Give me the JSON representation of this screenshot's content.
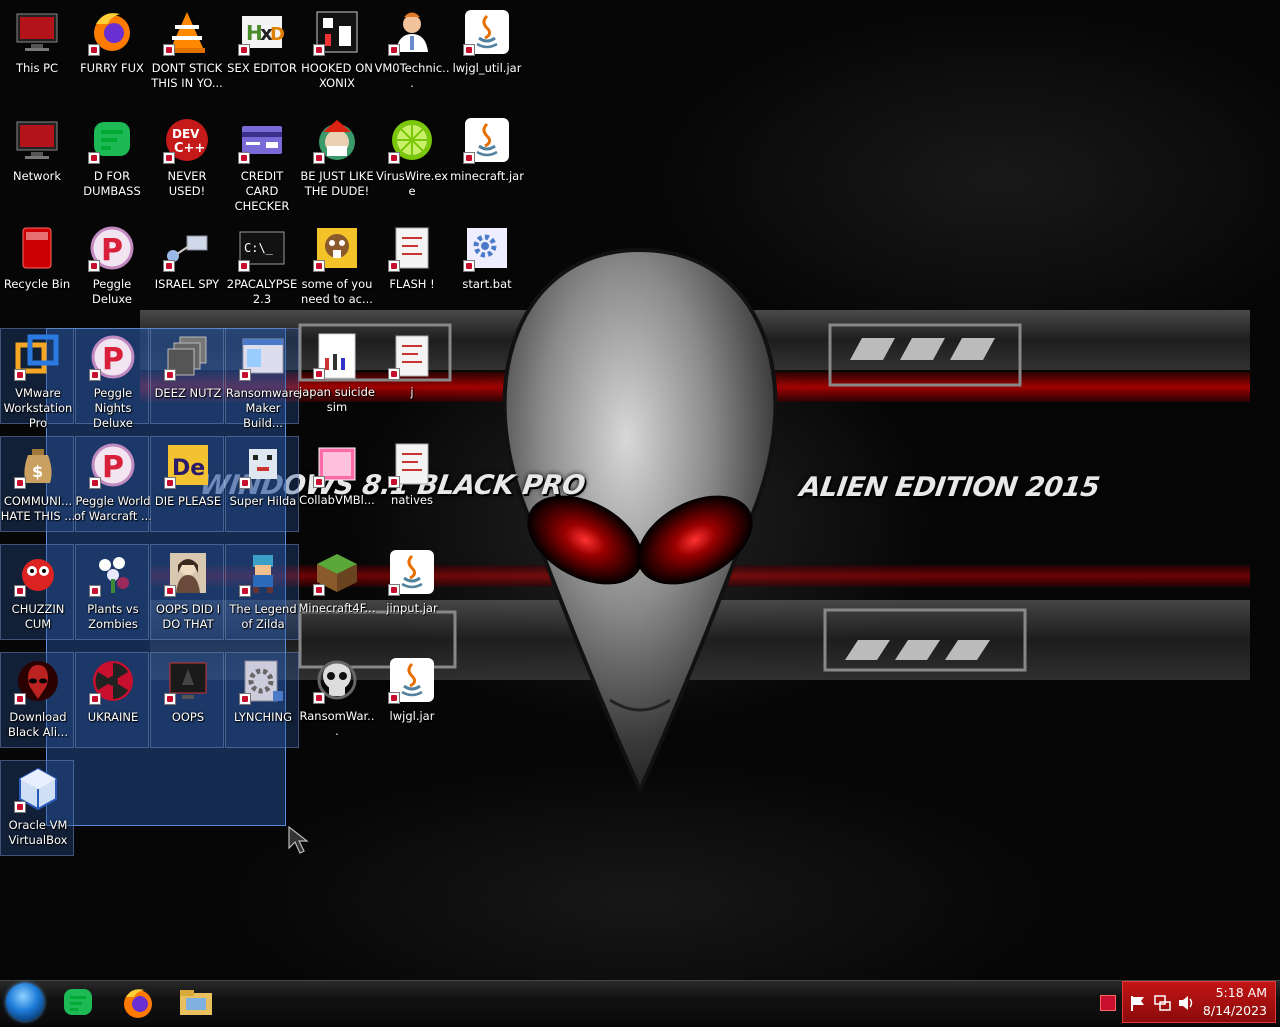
{
  "wallpaper": {
    "left_title": "WINDOWS 8.1 BLACK PRO",
    "right_title": "ALIEN EDITION 2015"
  },
  "desktop_icons": [
    {
      "label": "This PC",
      "icon": "computer-icon"
    },
    {
      "label": "FURRY FUX",
      "icon": "firefox-icon"
    },
    {
      "label": "DONT STICK THIS IN YO...",
      "icon": "vlc-icon"
    },
    {
      "label": "SEX EDITOR",
      "icon": "hex-editor-icon"
    },
    {
      "label": "HOOKED ON XONIX",
      "icon": "xonix-game-icon"
    },
    {
      "label": "VM0Technic...",
      "icon": "doctor-icon"
    },
    {
      "label": "lwjgl_util.jar",
      "icon": "java-icon"
    },
    {
      "label": "Network",
      "icon": "network-icon"
    },
    {
      "label": "D FOR DUMBASS",
      "icon": "chat-icon"
    },
    {
      "label": "NEVER USED!",
      "icon": "dev-cpp-icon"
    },
    {
      "label": "CREDIT CARD CHECKER",
      "icon": "credit-card-icon"
    },
    {
      "label": "BE JUST LIKE THE DUDE!",
      "icon": "santa-icon"
    },
    {
      "label": "VirusWire.exe",
      "icon": "lime-icon"
    },
    {
      "label": "minecraft.jar",
      "icon": "java-icon"
    },
    {
      "label": "Recycle Bin",
      "icon": "recycle-bin-icon"
    },
    {
      "label": "Peggle Deluxe",
      "icon": "peggle-icon"
    },
    {
      "label": "ISRAEL SPY",
      "icon": "network-share-icon"
    },
    {
      "label": "2PACALYPSE 2.3",
      "icon": "console-icon"
    },
    {
      "label": "some of you need to ac...",
      "icon": "beaver-icon"
    },
    {
      "label": "FLASH !",
      "icon": "folder-file-icon"
    },
    {
      "label": "start.bat",
      "icon": "gear-icon"
    },
    {
      "label": "VMware Workstation Pro",
      "icon": "vmware-icon"
    },
    {
      "label": "Peggle Nights Deluxe",
      "icon": "peggle-icon"
    },
    {
      "label": "DEEZ NUTZ",
      "icon": "stack-icon"
    },
    {
      "label": "Ransomware Maker Build...",
      "icon": "window-icon"
    },
    {
      "label": "japan suicide sim",
      "icon": "document-icon"
    },
    {
      "label": "j",
      "icon": "folder-file-icon"
    },
    {
      "label": "COMMUNI... HATE THIS ...",
      "icon": "money-bag-icon"
    },
    {
      "label": "Peggle World of Warcraft ...",
      "icon": "peggle-icon"
    },
    {
      "label": "DIE PLEASE",
      "icon": "de-icon"
    },
    {
      "label": "Super Hilda",
      "icon": "pixel-dog-icon"
    },
    {
      "label": "CollabVMBl...",
      "icon": "pink-window-icon"
    },
    {
      "label": "natives",
      "icon": "folder-file-icon"
    },
    {
      "label": "CHUZZIN CUM",
      "icon": "chuzzle-icon"
    },
    {
      "label": "Plants vs Zombies",
      "icon": "flower-icon"
    },
    {
      "label": "OOPS DID I DO THAT",
      "icon": "portrait-icon"
    },
    {
      "label": "The Legend of Zilda",
      "icon": "pixel-hero-icon"
    },
    {
      "label": "Minecraft4F...",
      "icon": "grass-block-icon"
    },
    {
      "label": "jinput.jar",
      "icon": "java-icon"
    },
    {
      "label": "Download Black Ali...",
      "icon": "alien-head-icon"
    },
    {
      "label": "UKRAINE",
      "icon": "radiation-icon"
    },
    {
      "label": "OOPS",
      "icon": "dark-monitor-icon"
    },
    {
      "label": "LYNCHING",
      "icon": "gear-doc-icon"
    },
    {
      "label": "RansomWar...",
      "icon": "skull-icon"
    },
    {
      "label": "lwjgl.jar",
      "icon": "java-icon"
    },
    {
      "label": "Oracle VM VirtualBox",
      "icon": "virtualbox-icon"
    }
  ],
  "taskbar": {
    "pinned": [
      {
        "name": "start-orb"
      },
      {
        "name": "chat-app",
        "icon": "chat-icon"
      },
      {
        "name": "firefox",
        "icon": "firefox-icon"
      },
      {
        "name": "file-explorer",
        "icon": "folder-icon"
      }
    ],
    "clock": {
      "time": "5:18 AM",
      "date": "8/14/2023"
    }
  }
}
